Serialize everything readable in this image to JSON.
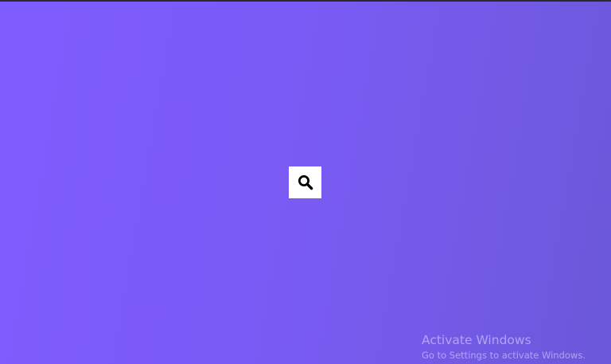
{
  "page": {
    "background_colors": [
      "#7f5cff",
      "#7a5bf5",
      "#735ae6",
      "#6b58d9"
    ]
  },
  "search": {
    "icon": "search-icon",
    "button_color": "#ffffff"
  },
  "watermark": {
    "title": "Activate Windows",
    "subtitle": "Go to Settings to activate Windows."
  }
}
